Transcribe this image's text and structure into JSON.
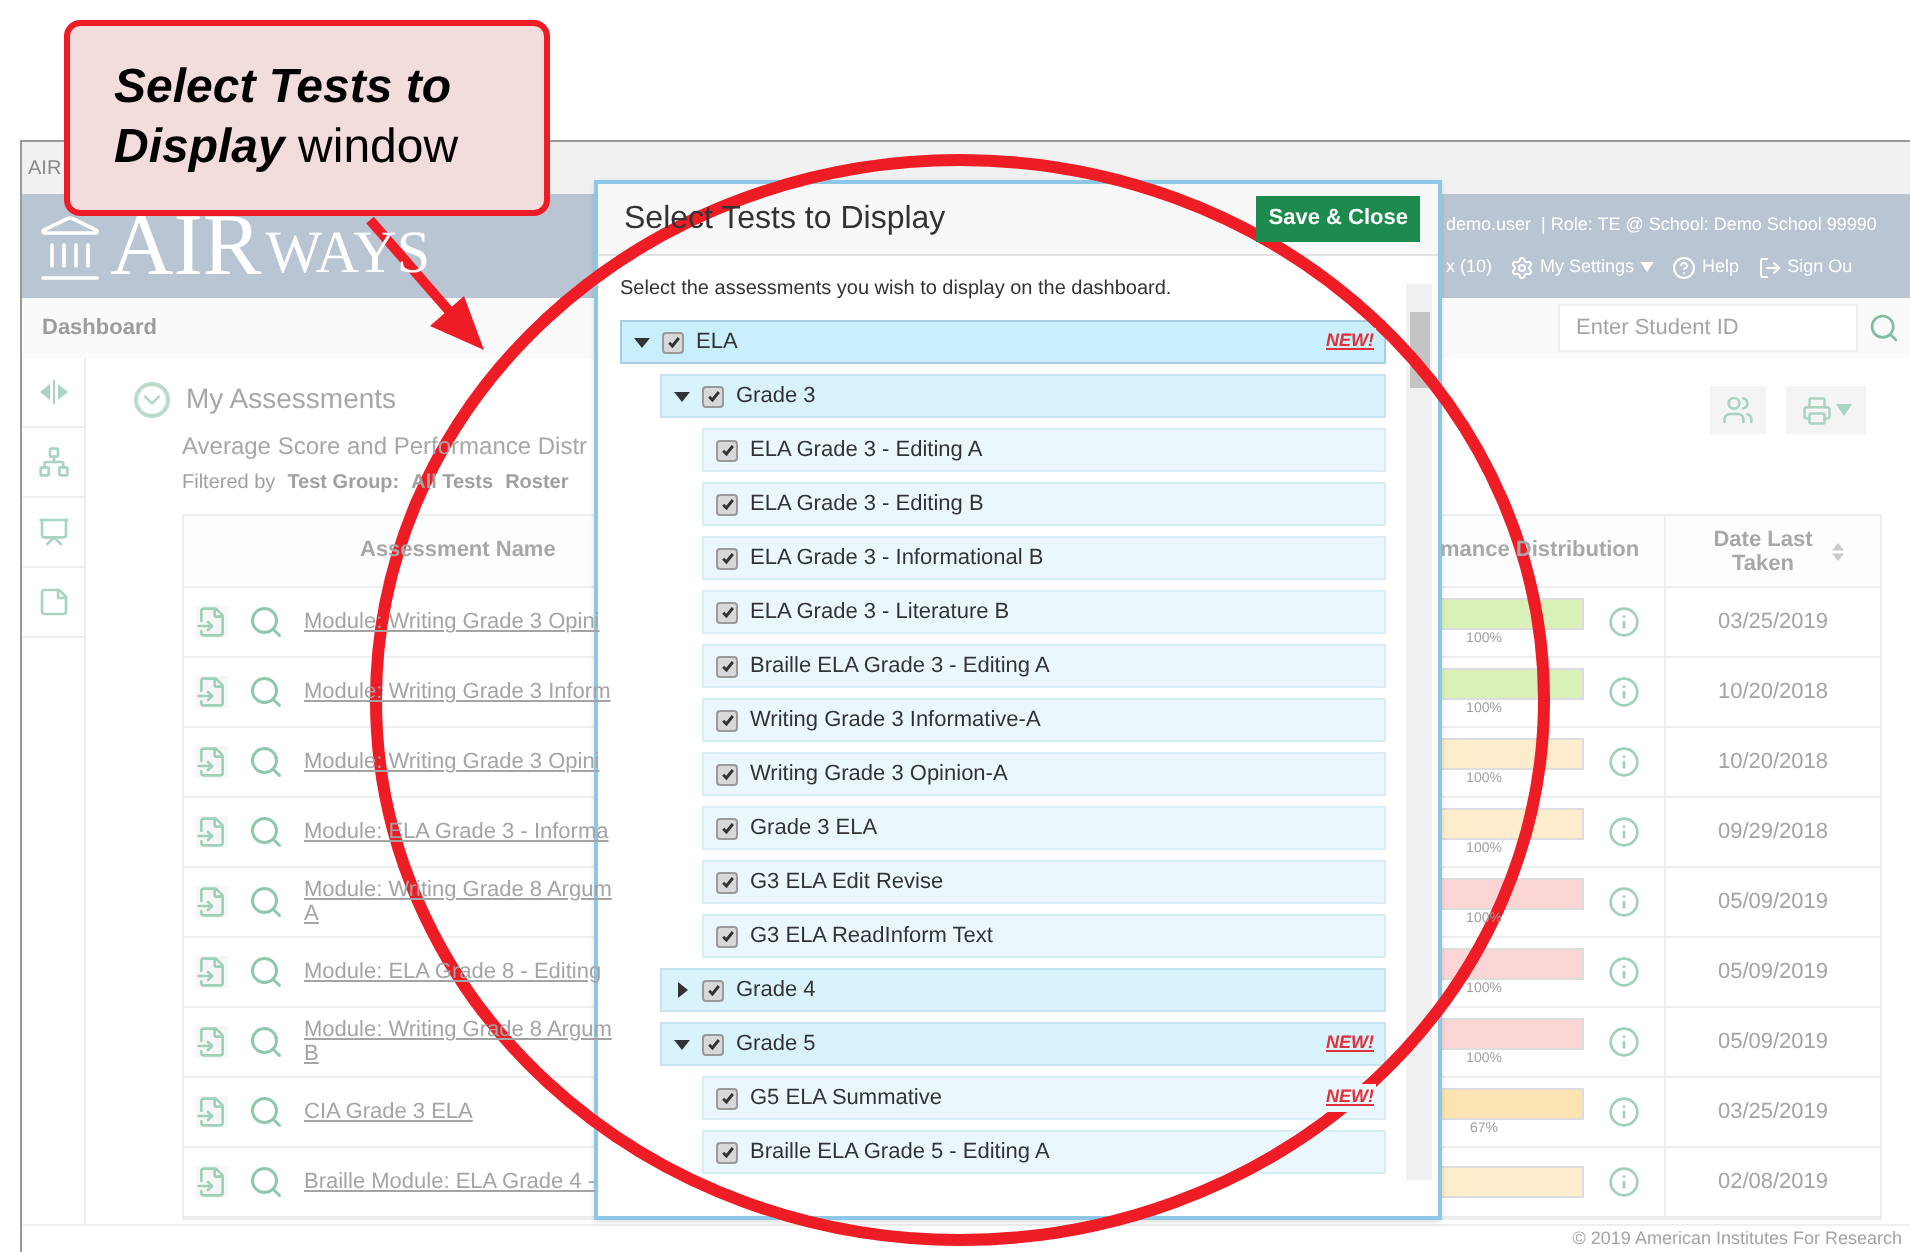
{
  "callout": {
    "text": "**Select Tests to Display** window"
  },
  "app": {
    "tab_label": "AIR",
    "logo": {
      "main": "AIR",
      "rest": "WAYS"
    },
    "user": "demo.user",
    "role": "| Role: TE @ School: Demo School 99990",
    "menu": [
      {
        "kind": "plain",
        "label": "x (10)"
      },
      {
        "kind": "settings",
        "label": "My Settings"
      },
      {
        "kind": "help",
        "label": "Help"
      },
      {
        "kind": "signout",
        "label": "Sign Ou"
      }
    ],
    "page_title": "Dashboard",
    "search": {
      "placeholder": "Enter Student ID"
    },
    "footer": "© 2019 American Institutes For Research"
  },
  "assessments": {
    "title": "My Assessments",
    "subtitle": "Average Score and Performance Distr",
    "filter_label": "Filtered by",
    "filters": [
      "Test Group:",
      "All Tests",
      "Roster"
    ],
    "columns": [
      "Assessment Name",
      "mance Distribution",
      "Date Last Taken"
    ],
    "rows": [
      {
        "name": "Module: Writing Grade 3 Opini",
        "color": "#d9f1b8",
        "percent": "100%",
        "date": "03/25/2019"
      },
      {
        "name": "Module: Writing Grade 3 Inform",
        "color": "#d9f1b8",
        "percent": "100%",
        "date": "10/20/2018"
      },
      {
        "name": "Module: Writing Grade 3 Opini",
        "color": "#fdedcc",
        "percent": "100%",
        "date": "10/20/2018"
      },
      {
        "name": "Module: ELA Grade 3 - Informa",
        "color": "#fdedcc",
        "percent": "100%",
        "date": "09/29/2018"
      },
      {
        "name": "Module: Writing Grade 8 Argum",
        "name_continued": "A",
        "color": "#fcd5d5",
        "percent": "100%",
        "date": "05/09/2019"
      },
      {
        "name": "Module: ELA Grade 8 - Editing",
        "color": "#fcd5d5",
        "percent": "100%",
        "date": "05/09/2019"
      },
      {
        "name": "Module: Writing Grade 8 Argum",
        "name_continued": "B",
        "color": "#fcd5d5",
        "percent": "100%",
        "date": "05/09/2019"
      },
      {
        "name": "CIA Grade 3 ELA",
        "color": "#fbe3b2",
        "percent": "67%",
        "date": "03/25/2019"
      },
      {
        "name": "Braille Module: ELA Grade 4 -",
        "color": "#fdedcc",
        "date": "02/08/2019"
      }
    ]
  },
  "modal": {
    "title": "Select Tests to Display",
    "save_button": "Save & Close",
    "instructions": "Select the assessments you wish to display on the dashboard.",
    "tree": [
      {
        "label": "ELA",
        "checked": true,
        "expanded": true,
        "badge": "NEW!",
        "children": [
          {
            "label": "Grade 3",
            "checked": true,
            "expanded": true,
            "children": [
              {
                "label": "ELA Grade 3 - Editing A",
                "checked": true
              },
              {
                "label": "ELA Grade 3 - Editing B",
                "checked": true
              },
              {
                "label": "ELA Grade 3 - Informational B",
                "checked": true
              },
              {
                "label": "ELA Grade 3 - Literature B",
                "checked": true
              },
              {
                "label": "Braille ELA Grade 3 - Editing A",
                "checked": true
              },
              {
                "label": "Writing Grade 3 Informative-A",
                "checked": true
              },
              {
                "label": "Writing Grade 3 Opinion-A",
                "checked": true
              },
              {
                "label": "Grade 3 ELA",
                "checked": true
              },
              {
                "label": "G3 ELA Edit Revise",
                "checked": true
              },
              {
                "label": "G3 ELA ReadInform Text",
                "checked": true
              }
            ]
          },
          {
            "label": "Grade 4",
            "checked": true,
            "expanded": false
          },
          {
            "label": "Grade 5",
            "checked": true,
            "expanded": true,
            "badge": "NEW!",
            "children": [
              {
                "label": "G5 ELA Summative",
                "checked": true,
                "badge": "NEW!"
              },
              {
                "label": "Braille ELA Grade 5 - Editing A",
                "checked": true
              }
            ]
          }
        ]
      }
    ]
  }
}
